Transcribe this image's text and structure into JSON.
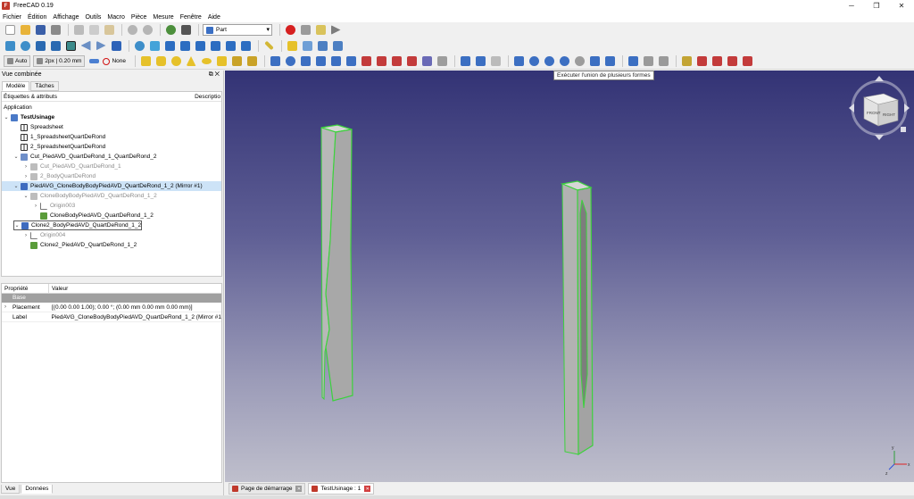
{
  "window": {
    "title": "FreeCAD 0.19",
    "app_icon": "freecad-icon"
  },
  "menu": [
    "Fichier",
    "Édition",
    "Affichage",
    "Outils",
    "Macro",
    "Pièce",
    "Mesure",
    "Fenêtre",
    "Aide"
  ],
  "toolbar": {
    "workbench": "Part",
    "auto_label": "Auto",
    "line_width": "2px | 0.20 mm",
    "none_label": "None"
  },
  "tooltip": "Exécuter l'union de plusieurs formes",
  "combo_view": {
    "title": "Vue combinée",
    "tabs": [
      "Modèle",
      "Tâches"
    ],
    "tree_header": {
      "labels": "Étiquettes & attributs",
      "desc": "Descriptio"
    },
    "tree": [
      {
        "label": "Application",
        "depth": 0,
        "icon": "",
        "arrow": ""
      },
      {
        "label": "TestUsinage",
        "depth": 1,
        "icon": "ico-doc",
        "arrow": "v",
        "bold": true
      },
      {
        "label": "Spreadsheet",
        "depth": 2,
        "icon": "ico-sheet",
        "arrow": ""
      },
      {
        "label": "1_SpreadsheetQuartDeRond",
        "depth": 2,
        "icon": "ico-sheet",
        "arrow": ""
      },
      {
        "label": "2_SpreadsheetQuartDeRond",
        "depth": 2,
        "icon": "ico-sheet",
        "arrow": ""
      },
      {
        "label": "Cut_PiedAVD_QuartDeRond_1_QuartDeRond_2",
        "depth": 2,
        "icon": "ico-cut",
        "arrow": "v"
      },
      {
        "label": "Cut_PiedAVD_QuartDeRond_1",
        "depth": 3,
        "icon": "ico-grey",
        "arrow": ">",
        "grey": true
      },
      {
        "label": "2_BodyQuartDeRond",
        "depth": 3,
        "icon": "ico-grey",
        "arrow": ">",
        "grey": true
      },
      {
        "label": "PiedAVG_CloneBodyBodyPiedAVD_QuartDeRond_1_2 (Mirror #1)",
        "depth": 2,
        "icon": "ico-blue",
        "arrow": "v",
        "sel": true
      },
      {
        "label": "CloneBodyBodyPiedAVD_QuartDeRond_1_2",
        "depth": 3,
        "icon": "ico-grey",
        "arrow": "v",
        "grey": true
      },
      {
        "label": "Origin003",
        "depth": 4,
        "icon": "ico-origin",
        "arrow": ">",
        "grey": true
      },
      {
        "label": "CloneBodyPiedAVD_QuartDeRond_1_2",
        "depth": 4,
        "icon": "ico-clone",
        "arrow": ""
      },
      {
        "label": "Clone2_BodyPiedAVD_QuartDeRond_1_2",
        "depth": 2,
        "icon": "ico-blue",
        "arrow": "v",
        "edit": true
      },
      {
        "label": "Origin004",
        "depth": 3,
        "icon": "ico-origin",
        "arrow": ">",
        "grey": true
      },
      {
        "label": "Clone2_PiedAVD_QuartDeRond_1_2",
        "depth": 3,
        "icon": "ico-clone",
        "arrow": ""
      }
    ],
    "props": {
      "col_property": "Propriété",
      "col_value": "Valeur",
      "group": "Base",
      "rows": [
        {
          "name": "Placement",
          "value": "[(0.00 0.00 1.00); 0.00 °; (0.00 mm  0.00 mm  0.00 mm)]",
          "arrow": ">"
        },
        {
          "name": "Label",
          "value": "PiedAVG_CloneBodyBodyPiedAVD_QuartDeRond_1_2 (Mirror #1)",
          "arrow": ""
        }
      ]
    },
    "bottom_tabs": [
      "Vue",
      "Données"
    ]
  },
  "navcube": {
    "front": "FRONT",
    "right": "RIGHT"
  },
  "axis_labels": {
    "x": "x",
    "y": "y",
    "z": "z"
  },
  "view_tabs": [
    {
      "label": "Page de démarrage",
      "active": false
    },
    {
      "label": "TestUsinage : 1",
      "active": true
    }
  ],
  "colors": {
    "accent": "#3d6bbf",
    "record": "#d62020",
    "edge": "#3cd23c"
  }
}
